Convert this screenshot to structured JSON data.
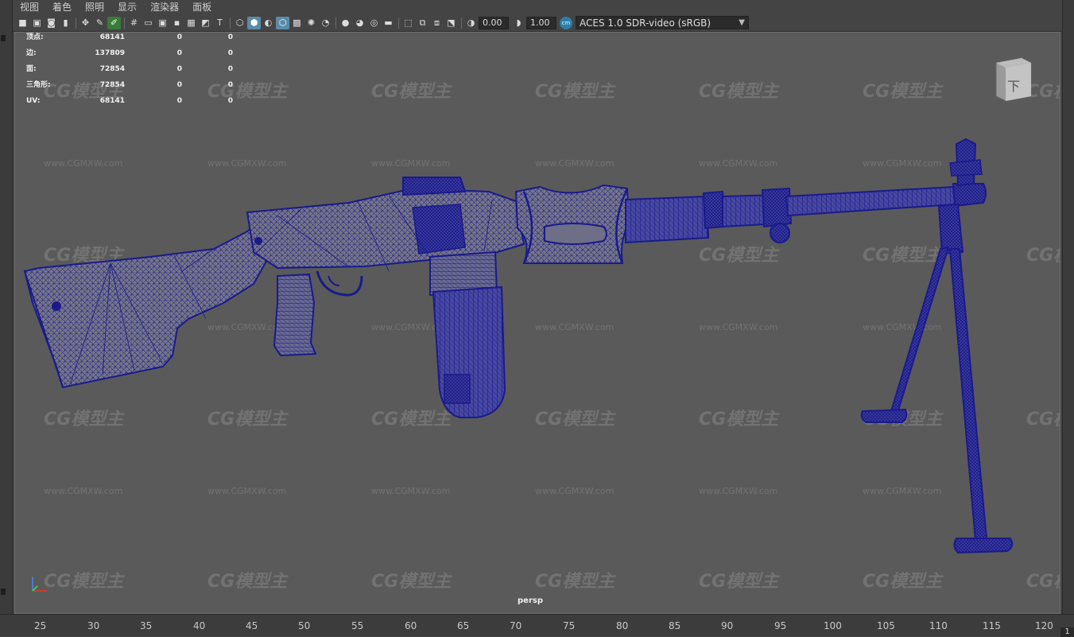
{
  "menu": {
    "items": [
      "视图",
      "着色",
      "照明",
      "显示",
      "渲染器",
      "面板"
    ]
  },
  "toolbar": {
    "exposure_value": "0.00",
    "gamma_value": "1.00",
    "color_space_icon": "cm",
    "color_space": "ACES 1.0 SDR-video (sRGB)"
  },
  "hud": {
    "rows": [
      {
        "label": "顶点:",
        "v1": "68141",
        "v2": "0",
        "v3": "0"
      },
      {
        "label": "边:",
        "v1": "137809",
        "v2": "0",
        "v3": "0"
      },
      {
        "label": "面:",
        "v1": "72854",
        "v2": "0",
        "v3": "0"
      },
      {
        "label": "三角形:",
        "v1": "72854",
        "v2": "0",
        "v3": "0"
      },
      {
        "label": "UV:",
        "v1": "68141",
        "v2": "0",
        "v3": "0"
      }
    ]
  },
  "viewport": {
    "camera": "persp",
    "view_cube_label": "下",
    "wireframe_color": "#1a1a8c",
    "background_color": "#5a5a5a"
  },
  "watermark": {
    "logo_text": "CG模型主",
    "url_text": "www.CGMXW.com"
  },
  "timeline": {
    "ticks": [
      "25",
      "30",
      "35",
      "40",
      "45",
      "50",
      "55",
      "60",
      "65",
      "70",
      "75",
      "80",
      "85",
      "90",
      "95",
      "100",
      "105",
      "110",
      "115",
      "120"
    ],
    "current_frame": "1"
  }
}
